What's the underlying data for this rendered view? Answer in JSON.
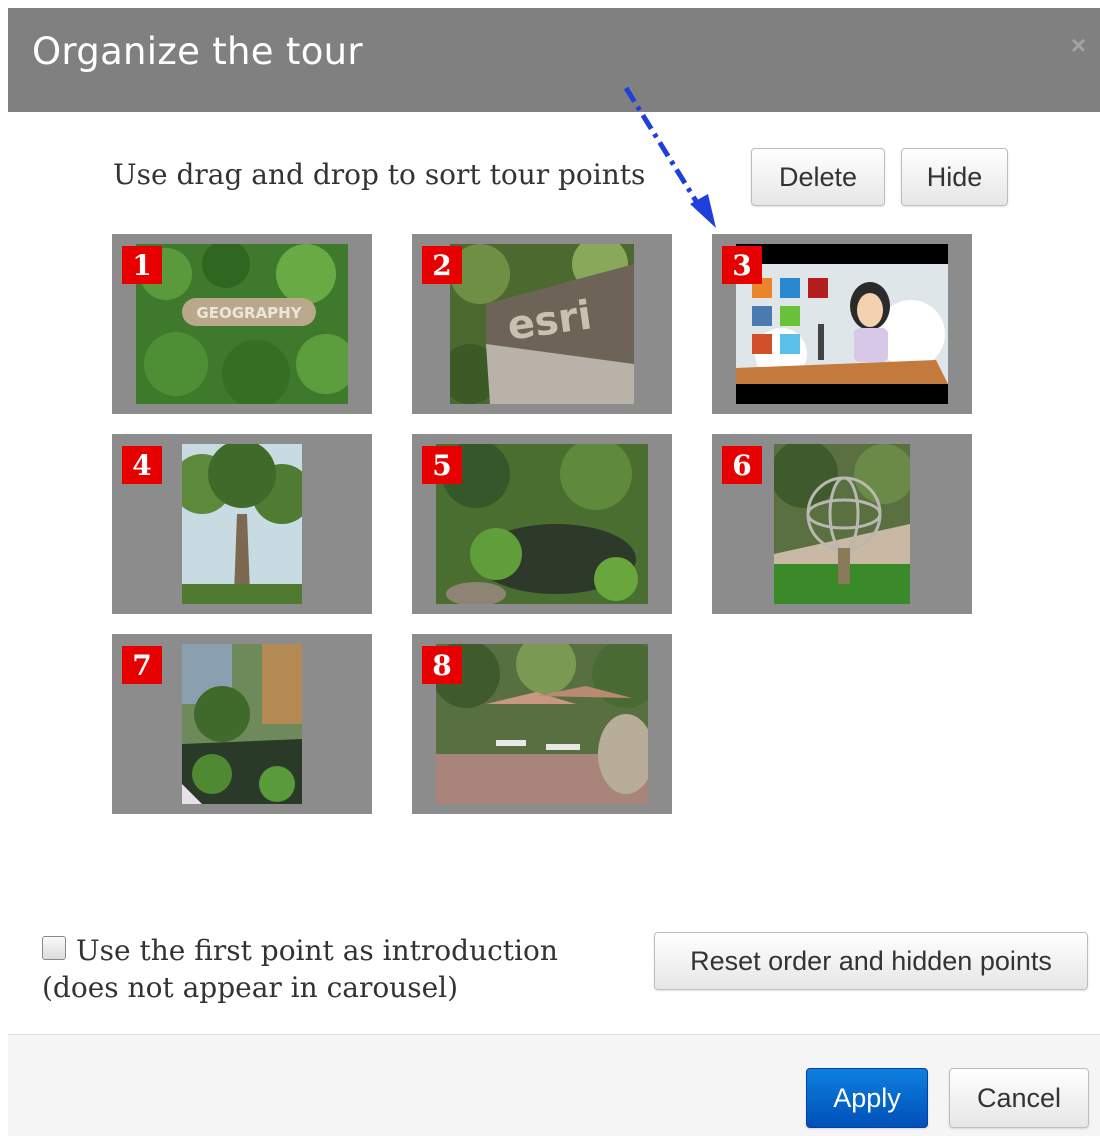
{
  "dialog": {
    "title": "Organize the tour",
    "close_glyph": "×"
  },
  "instruction": "Use drag and drop to sort tour points",
  "toolbar": {
    "delete_label": "Delete",
    "hide_label": "Hide"
  },
  "points": [
    {
      "number": "1",
      "image": "geography-ivy-sign"
    },
    {
      "number": "2",
      "image": "esri-sign"
    },
    {
      "number": "3",
      "image": "cartoon-office-worker"
    },
    {
      "number": "4",
      "image": "palm-tree"
    },
    {
      "number": "5",
      "image": "garden-pond"
    },
    {
      "number": "6",
      "image": "armillary-sphere-sculpture"
    },
    {
      "number": "7",
      "image": "courtyard-pond"
    },
    {
      "number": "8",
      "image": "patio-tables-umbrellas"
    }
  ],
  "options": {
    "intro_label": "Use the first point as introduction (does not appear in carousel)",
    "intro_checked": false,
    "reset_label": "Reset order and hidden points"
  },
  "footer": {
    "apply_label": "Apply",
    "cancel_label": "Cancel"
  },
  "colors": {
    "header_bg": "#808080",
    "tile_bg": "#8c8c8c",
    "number_badge": "#e60000",
    "apply_button": "#0a6fd6",
    "annotation_arrow": "#1f3fdc"
  }
}
